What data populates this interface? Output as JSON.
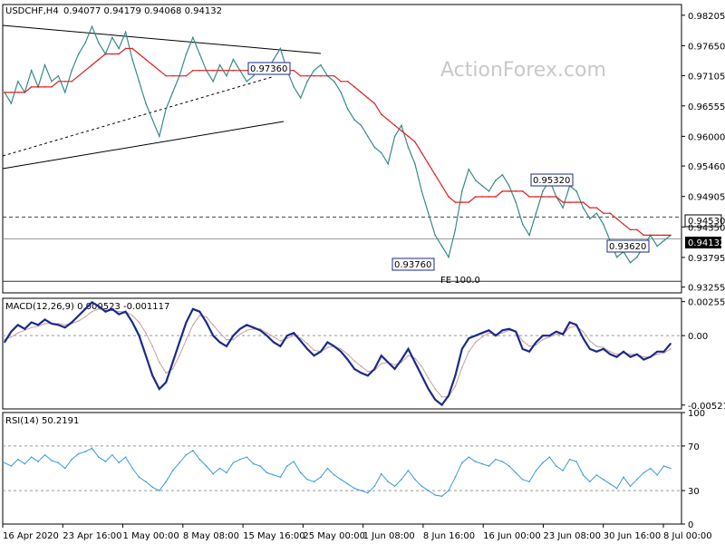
{
  "header": {
    "symbol_tf": "USDCHF,H4",
    "ohlc": "0.94077 0.94179 0.94068 0.94132"
  },
  "watermark": "ActionForex.com",
  "colors": {
    "price_line": "#3a8a8a",
    "ma_line": "#e02020",
    "macd_line": "#1a2a8a",
    "signal_line": "#c8a0a0",
    "rsi_line": "#3a9ad9",
    "axis": "#000000",
    "level_dash": "#444444",
    "label_box": "#1a2a8a"
  },
  "annotations": [
    {
      "text": "0.97360"
    },
    {
      "text": "0.95320"
    },
    {
      "text": "0.93760"
    },
    {
      "text": "0.93620"
    },
    {
      "text": "FE 100.0"
    }
  ],
  "right_labels": [
    {
      "text": "0.94530"
    },
    {
      "text": "0.94132"
    }
  ],
  "chart_data": [
    {
      "type": "line",
      "title": "USDCHF,H4",
      "ylim": [
        0.9315,
        0.984
      ],
      "yticks": [
        "0.98205",
        "0.97650",
        "0.97105",
        "0.96555",
        "0.96000",
        "0.95460",
        "0.94905",
        "0.94350",
        "0.93795",
        "0.93255"
      ],
      "ytick_values": [
        0.98205,
        0.9765,
        0.97105,
        0.96555,
        0.96,
        0.9546,
        0.94905,
        0.9435,
        0.93795,
        0.93255
      ],
      "xtick_labels": [
        "16 Apr 2020",
        "23 Apr 16:00",
        "1 May 00:00",
        "8 May 08:00",
        "15 May 16:00",
        "25 May 00:00",
        "1 Jun 08:00",
        "8 Jun 16:00",
        "16 Jun 00:00",
        "23 Jun 08:00",
        "30 Jun 16:00",
        "8 Jul 00:00"
      ],
      "levels": [
        0.9453,
        0.94132,
        0.9336
      ],
      "series": [
        {
          "values": [
            0.968,
            0.966,
            0.97,
            0.968,
            0.972,
            0.969,
            0.973,
            0.97,
            0.971,
            0.968,
            0.972,
            0.975,
            0.977,
            0.98,
            0.977,
            0.975,
            0.978,
            0.976,
            0.979,
            0.974,
            0.97,
            0.966,
            0.963,
            0.96,
            0.965,
            0.968,
            0.971,
            0.975,
            0.978,
            0.975,
            0.972,
            0.97,
            0.973,
            0.971,
            0.974,
            0.972,
            0.97,
            0.971,
            0.973,
            0.972,
            0.974,
            0.976,
            0.972,
            0.969,
            0.967,
            0.97,
            0.972,
            0.973,
            0.971,
            0.97,
            0.968,
            0.965,
            0.963,
            0.962,
            0.96,
            0.958,
            0.957,
            0.955,
            0.96,
            0.962,
            0.958,
            0.955,
            0.95,
            0.946,
            0.942,
            0.94,
            0.938,
            0.943,
            0.95,
            0.954,
            0.952,
            0.951,
            0.95,
            0.952,
            0.953,
            0.951,
            0.948,
            0.944,
            0.942,
            0.946,
            0.95,
            0.952,
            0.949,
            0.947,
            0.951,
            0.95,
            0.947,
            0.945,
            0.946,
            0.944,
            0.941,
            0.938,
            0.939,
            0.937,
            0.938,
            0.94,
            0.942,
            0.94,
            0.941,
            0.942
          ]
        },
        {
          "values": [
            0.968,
            0.968,
            0.968,
            0.968,
            0.969,
            0.969,
            0.969,
            0.969,
            0.97,
            0.97,
            0.97,
            0.971,
            0.972,
            0.973,
            0.974,
            0.975,
            0.975,
            0.975,
            0.976,
            0.976,
            0.975,
            0.974,
            0.973,
            0.972,
            0.971,
            0.971,
            0.971,
            0.971,
            0.972,
            0.972,
            0.972,
            0.972,
            0.972,
            0.972,
            0.972,
            0.972,
            0.972,
            0.972,
            0.972,
            0.972,
            0.972,
            0.972,
            0.972,
            0.972,
            0.971,
            0.971,
            0.971,
            0.971,
            0.971,
            0.971,
            0.97,
            0.97,
            0.969,
            0.968,
            0.967,
            0.966,
            0.964,
            0.963,
            0.962,
            0.961,
            0.96,
            0.959,
            0.957,
            0.955,
            0.953,
            0.951,
            0.949,
            0.948,
            0.948,
            0.948,
            0.949,
            0.949,
            0.949,
            0.949,
            0.95,
            0.95,
            0.95,
            0.95,
            0.949,
            0.949,
            0.949,
            0.949,
            0.949,
            0.948,
            0.948,
            0.948,
            0.948,
            0.947,
            0.947,
            0.946,
            0.946,
            0.945,
            0.944,
            0.943,
            0.943,
            0.942,
            0.942,
            0.942,
            0.942,
            0.942
          ]
        }
      ]
    },
    {
      "type": "line",
      "title": "MACD(12,26,9) 0.000523 -0.001117",
      "ylim": [
        -0.0055,
        0.0028
      ],
      "yticks": [
        "0.002553",
        "0.00",
        "-0.005212"
      ],
      "ytick_values": [
        0.002553,
        0.0,
        -0.005212
      ],
      "series": [
        {
          "values": [
            -0.0005,
            0.0003,
            0.0008,
            0.0005,
            0.001,
            0.0008,
            0.0012,
            0.0009,
            0.0008,
            0.0006,
            0.001,
            0.0015,
            0.002,
            0.0025,
            0.0022,
            0.0018,
            0.002,
            0.0016,
            0.0018,
            0.001,
            0.0,
            -0.0015,
            -0.003,
            -0.004,
            -0.0035,
            -0.002,
            -0.0005,
            0.001,
            0.002,
            0.0018,
            0.001,
            0.0,
            -0.0005,
            -0.0008,
            0.0,
            0.0005,
            0.0008,
            0.0006,
            0.0004,
            0.0,
            -0.0005,
            -0.0008,
            0.0,
            0.0002,
            -0.0004,
            -0.001,
            -0.0015,
            -0.0012,
            -0.0005,
            -0.0008,
            -0.0012,
            -0.0018,
            -0.0025,
            -0.0028,
            -0.003,
            -0.0025,
            -0.0015,
            -0.002,
            -0.0025,
            -0.0018,
            -0.001,
            -0.002,
            -0.003,
            -0.004,
            -0.0048,
            -0.0052,
            -0.0045,
            -0.003,
            -0.001,
            -0.0002,
            0.0,
            0.0002,
            0.0004,
            0.0,
            0.0004,
            0.0005,
            0.0003,
            -0.001,
            -0.0012,
            -0.0005,
            0.0,
            0.0,
            0.0003,
            0.0001,
            0.001,
            0.0008,
            -0.0002,
            -0.001,
            -0.0012,
            -0.001,
            -0.0014,
            -0.0016,
            -0.0012,
            -0.0016,
            -0.0014,
            -0.0018,
            -0.0016,
            -0.0012,
            -0.0012,
            -0.0006
          ]
        },
        {
          "values": [
            -0.0003,
            -0.0001,
            0.0002,
            0.0004,
            0.0006,
            0.0007,
            0.0009,
            0.0009,
            0.0009,
            0.0008,
            0.0009,
            0.0011,
            0.0014,
            0.0018,
            0.002,
            0.0019,
            0.0019,
            0.0018,
            0.0018,
            0.0015,
            0.001,
            0.0002,
            -0.0008,
            -0.002,
            -0.0028,
            -0.0025,
            -0.0015,
            -0.0003,
            0.0008,
            0.0015,
            0.0014,
            0.0008,
            0.0002,
            -0.0003,
            -0.0003,
            0.0001,
            0.0004,
            0.0005,
            0.0005,
            0.0002,
            -0.0001,
            -0.0004,
            -0.0002,
            0.0,
            -0.0002,
            -0.0006,
            -0.0011,
            -0.0012,
            -0.0009,
            -0.0008,
            -0.001,
            -0.0014,
            -0.0019,
            -0.0023,
            -0.0027,
            -0.0026,
            -0.0021,
            -0.002,
            -0.0022,
            -0.002,
            -0.0015,
            -0.0017,
            -0.0023,
            -0.0032,
            -0.004,
            -0.0046,
            -0.0046,
            -0.0038,
            -0.0024,
            -0.0012,
            -0.0005,
            -0.0001,
            0.0002,
            0.0001,
            0.0002,
            0.0004,
            0.0003,
            -0.0004,
            -0.0008,
            -0.0007,
            -0.0003,
            -0.0001,
            0.0001,
            0.0001,
            0.0006,
            0.0007,
            0.0003,
            -0.0004,
            -0.0008,
            -0.0009,
            -0.0012,
            -0.0014,
            -0.0013,
            -0.0014,
            -0.0014,
            -0.0016,
            -0.0016,
            -0.0014,
            -0.0013,
            -0.001
          ]
        }
      ]
    },
    {
      "type": "line",
      "title": "RSI(14) 50.2191",
      "ylim": [
        0,
        100
      ],
      "yticks": [
        "100",
        "70",
        "30",
        "0"
      ],
      "ytick_values": [
        100,
        70,
        30,
        0
      ],
      "levels": [
        70,
        30
      ],
      "series": [
        {
          "values": [
            55,
            52,
            58,
            54,
            60,
            56,
            62,
            57,
            55,
            50,
            58,
            63,
            65,
            68,
            60,
            56,
            62,
            55,
            60,
            50,
            42,
            38,
            33,
            30,
            38,
            48,
            55,
            62,
            66,
            58,
            52,
            45,
            50,
            46,
            55,
            58,
            60,
            54,
            52,
            46,
            44,
            42,
            52,
            56,
            46,
            40,
            38,
            42,
            50,
            44,
            40,
            36,
            32,
            30,
            28,
            34,
            45,
            38,
            34,
            40,
            48,
            40,
            34,
            30,
            26,
            25,
            30,
            42,
            55,
            60,
            56,
            54,
            52,
            58,
            56,
            52,
            46,
            40,
            38,
            48,
            55,
            60,
            52,
            48,
            58,
            56,
            44,
            38,
            44,
            40,
            36,
            32,
            42,
            34,
            40,
            46,
            50,
            44,
            52,
            50
          ]
        }
      ]
    }
  ]
}
